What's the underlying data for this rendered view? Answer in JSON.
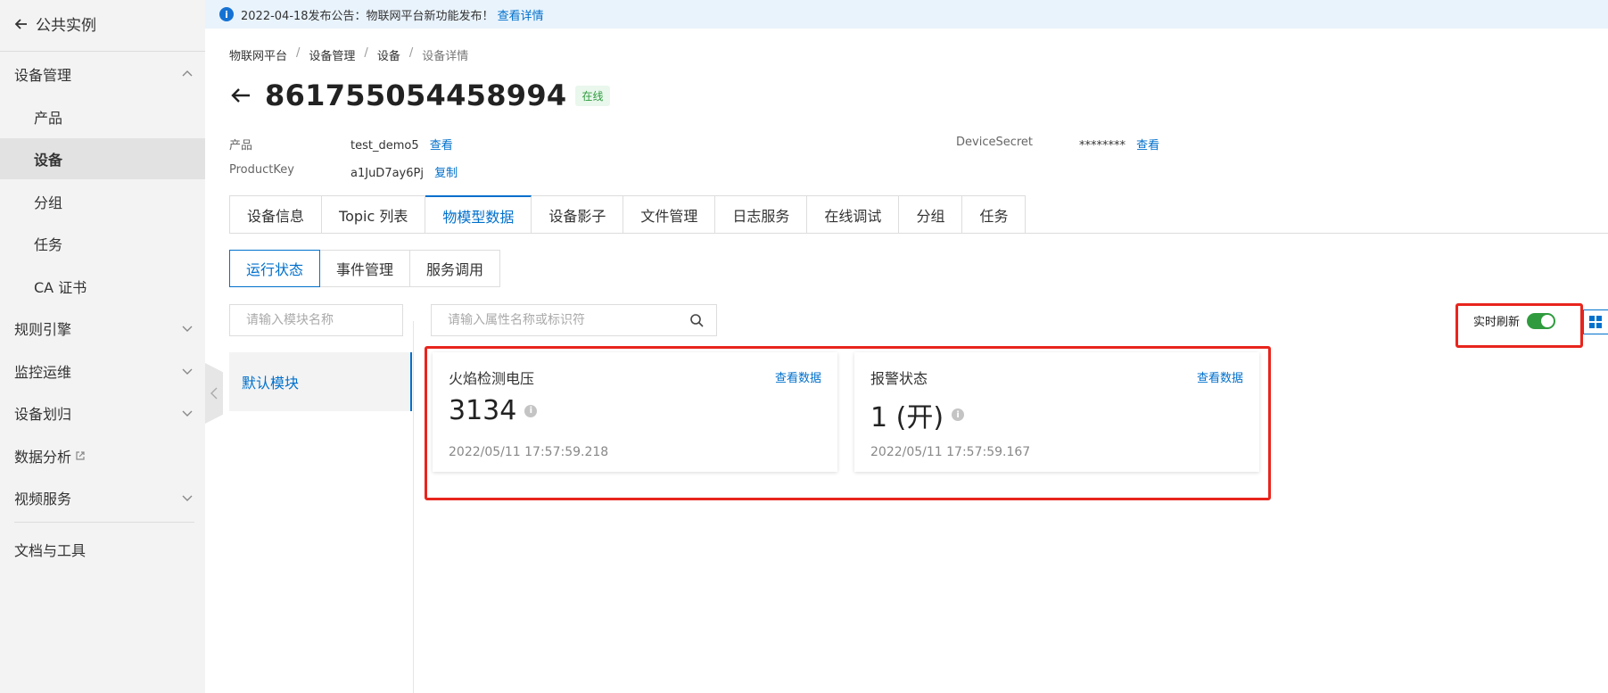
{
  "sidebar": {
    "back_label": "公共实例",
    "items": [
      {
        "label": "设备管理",
        "chevron": "up"
      },
      {
        "label": "产品"
      },
      {
        "label": "设备"
      },
      {
        "label": "分组"
      },
      {
        "label": "任务"
      },
      {
        "label": "CA 证书"
      },
      {
        "label": "规则引擎",
        "chevron": "down"
      },
      {
        "label": "监控运维",
        "chevron": "down"
      },
      {
        "label": "设备划归",
        "chevron": "down"
      },
      {
        "label": "数据分析"
      },
      {
        "label": "视频服务",
        "chevron": "down"
      },
      {
        "label": "文档与工具"
      }
    ]
  },
  "banner": {
    "text": "2022-04-18发布公告：物联网平台新功能发布！",
    "link": "查看详情"
  },
  "breadcrumb": [
    "物联网平台",
    "设备管理",
    "设备",
    "设备详情"
  ],
  "device": {
    "name": "861755054458994",
    "status": "在线",
    "product_key_label": "产品",
    "product_value": "test_demo5",
    "product_link": "查看",
    "productkey_label": "ProductKey",
    "productkey_value": "a1JuD7ay6Pj",
    "productkey_link": "复制",
    "secret_label": "DeviceSecret",
    "secret_value": "********",
    "secret_link": "查看"
  },
  "tabs": [
    "设备信息",
    "Topic 列表",
    "物模型数据",
    "设备影子",
    "文件管理",
    "日志服务",
    "在线调试",
    "分组",
    "任务"
  ],
  "subtabs": [
    "运行状态",
    "事件管理",
    "服务调用"
  ],
  "module_search_placeholder": "请输入模块名称",
  "property_search_placeholder": "请输入属性名称或标识符",
  "module": "默认模块",
  "realtime_label": "实时刷新",
  "realtime_enabled": true,
  "cards": [
    {
      "title": "火焰检测电压",
      "link": "查看数据",
      "value": "3134",
      "time": "2022/05/11 17:57:59.218"
    },
    {
      "title": "报警状态",
      "link": "查看数据",
      "value": "1 (开)",
      "time": "2022/05/11 17:57:59.167"
    }
  ],
  "colors": {
    "accent": "#0070cc",
    "online": "#2f9b3e",
    "highlight": "#e8251d",
    "sidebar_bg": "#f3f3f3"
  }
}
